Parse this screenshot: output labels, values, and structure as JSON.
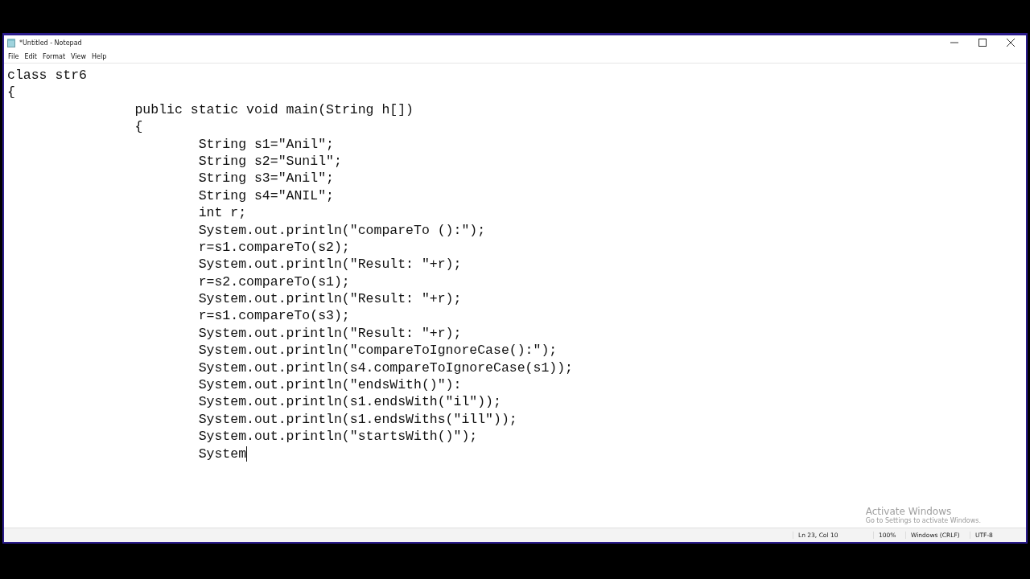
{
  "window": {
    "title": "*Untitled - Notepad"
  },
  "menu": [
    "File",
    "Edit",
    "Format",
    "View",
    "Help"
  ],
  "editor": {
    "lines": [
      "class str6",
      "{",
      "\t\tpublic static void main(String h[])",
      "\t\t{",
      "\t\t\tString s1=\"Anil\";",
      "\t\t\tString s2=\"Sunil\";",
      "\t\t\tString s3=\"Anil\";",
      "\t\t\tString s4=\"ANIL\";",
      "\t\t\tint r;",
      "\t\t\tSystem.out.println(\"compareTo ():\");",
      "\t\t\tr=s1.compareTo(s2);",
      "\t\t\tSystem.out.println(\"Result: \"+r);",
      "\t\t\tr=s2.compareTo(s1);",
      "\t\t\tSystem.out.println(\"Result: \"+r);",
      "\t\t\tr=s1.compareTo(s3);",
      "\t\t\tSystem.out.println(\"Result: \"+r);",
      "\t\t\tSystem.out.println(\"compareToIgnoreCase():\");",
      "\t\t\tSystem.out.println(s4.compareToIgnoreCase(s1));",
      "\t\t\tSystem.out.println(\"endsWith()\"):",
      "\t\t\tSystem.out.println(s1.endsWith(\"il\"));",
      "\t\t\tSystem.out.println(s1.endsWiths(\"ill\"));",
      "\t\t\tSystem.out.println(\"startsWith()\");",
      "\t\t\tSystem"
    ]
  },
  "activation": {
    "title": "Activate Windows",
    "message": "Go to Settings to activate Windows."
  },
  "status_bar": {
    "position": "Ln 23, Col 10",
    "zoom": "100%",
    "line_endings": "Windows (CRLF)",
    "encoding": "UTF-8"
  }
}
